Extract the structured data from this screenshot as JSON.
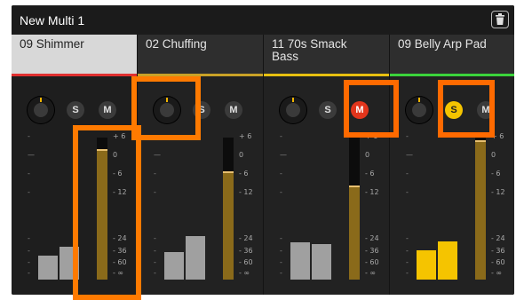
{
  "window": {
    "title": "New Multi 1",
    "delete_icon": "trash-icon"
  },
  "strips": [
    {
      "name": "09 Shimmer",
      "name_line2": "",
      "selected": true,
      "accent": "#e03030",
      "solo_label": "S",
      "mute_label": "M",
      "mute_on": false,
      "solo_on": false,
      "meter_level": 0.92,
      "bars": [
        0.45,
        0.62
      ],
      "bar_color": "#a0a0a0"
    },
    {
      "name": "02 Chuffing",
      "name_line2": "",
      "selected": false,
      "accent": "#c9a227",
      "solo_label": "S",
      "mute_label": "M",
      "mute_on": false,
      "solo_on": false,
      "meter_level": 0.76,
      "bars": [
        0.52,
        0.82
      ],
      "bar_color": "#a0a0a0"
    },
    {
      "name": "11 70s Smack",
      "name_line2": "Bass",
      "selected": false,
      "accent": "#e7c010",
      "solo_label": "S",
      "mute_label": "M",
      "mute_on": true,
      "solo_on": false,
      "meter_level": 0.66,
      "bars": [
        0.7,
        0.66
      ],
      "bar_color": "#a0a0a0"
    },
    {
      "name": "09 Belly Arp Pad",
      "name_line2": "",
      "selected": false,
      "accent": "#3bd43b",
      "solo_label": "S",
      "mute_label": "M",
      "mute_on": false,
      "solo_on": true,
      "meter_level": 0.98,
      "bars": [
        0.55,
        0.72
      ],
      "bar_color": "#f5c400"
    }
  ],
  "scale": [
    "+ 6",
    "0",
    "- 6",
    "- 12",
    "- 24",
    "- 36",
    "- 60",
    "- ∞"
  ]
}
